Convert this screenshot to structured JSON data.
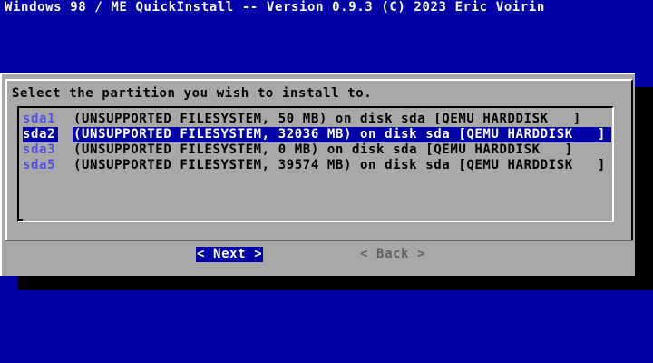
{
  "window": {
    "title": "Windows 98 / ME QuickInstall -- Version 0.9.3 (C) 2023 Eric Voirin"
  },
  "dialog": {
    "prompt": "Select the partition you wish to install to.",
    "partitions": [
      {
        "name": "sda1",
        "description": "(UNSUPPORTED FILESYSTEM, 50 MB) on disk sda [QEMU HARDDISK   ]",
        "selected": false
      },
      {
        "name": "sda2",
        "description": "(UNSUPPORTED FILESYSTEM, 32036 MB) on disk sda [QEMU HARDDISK   ]",
        "selected": true
      },
      {
        "name": "sda3",
        "description": "(UNSUPPORTED FILESYSTEM, 0 MB) on disk sda [QEMU HARDDISK   ]",
        "selected": false
      },
      {
        "name": "sda5",
        "description": "(UNSUPPORTED FILESYSTEM, 39574 MB) on disk sda [QEMU HARDDISK   ]",
        "selected": false
      }
    ],
    "buttons": {
      "next_label": "< Next >",
      "back_label": "< Back >"
    }
  },
  "colors": {
    "background": "#0000a8",
    "dialog": "#a8a8a8",
    "highlight": "#0000a8",
    "partition_name": "#5050e8",
    "disabled_text": "#606060"
  }
}
